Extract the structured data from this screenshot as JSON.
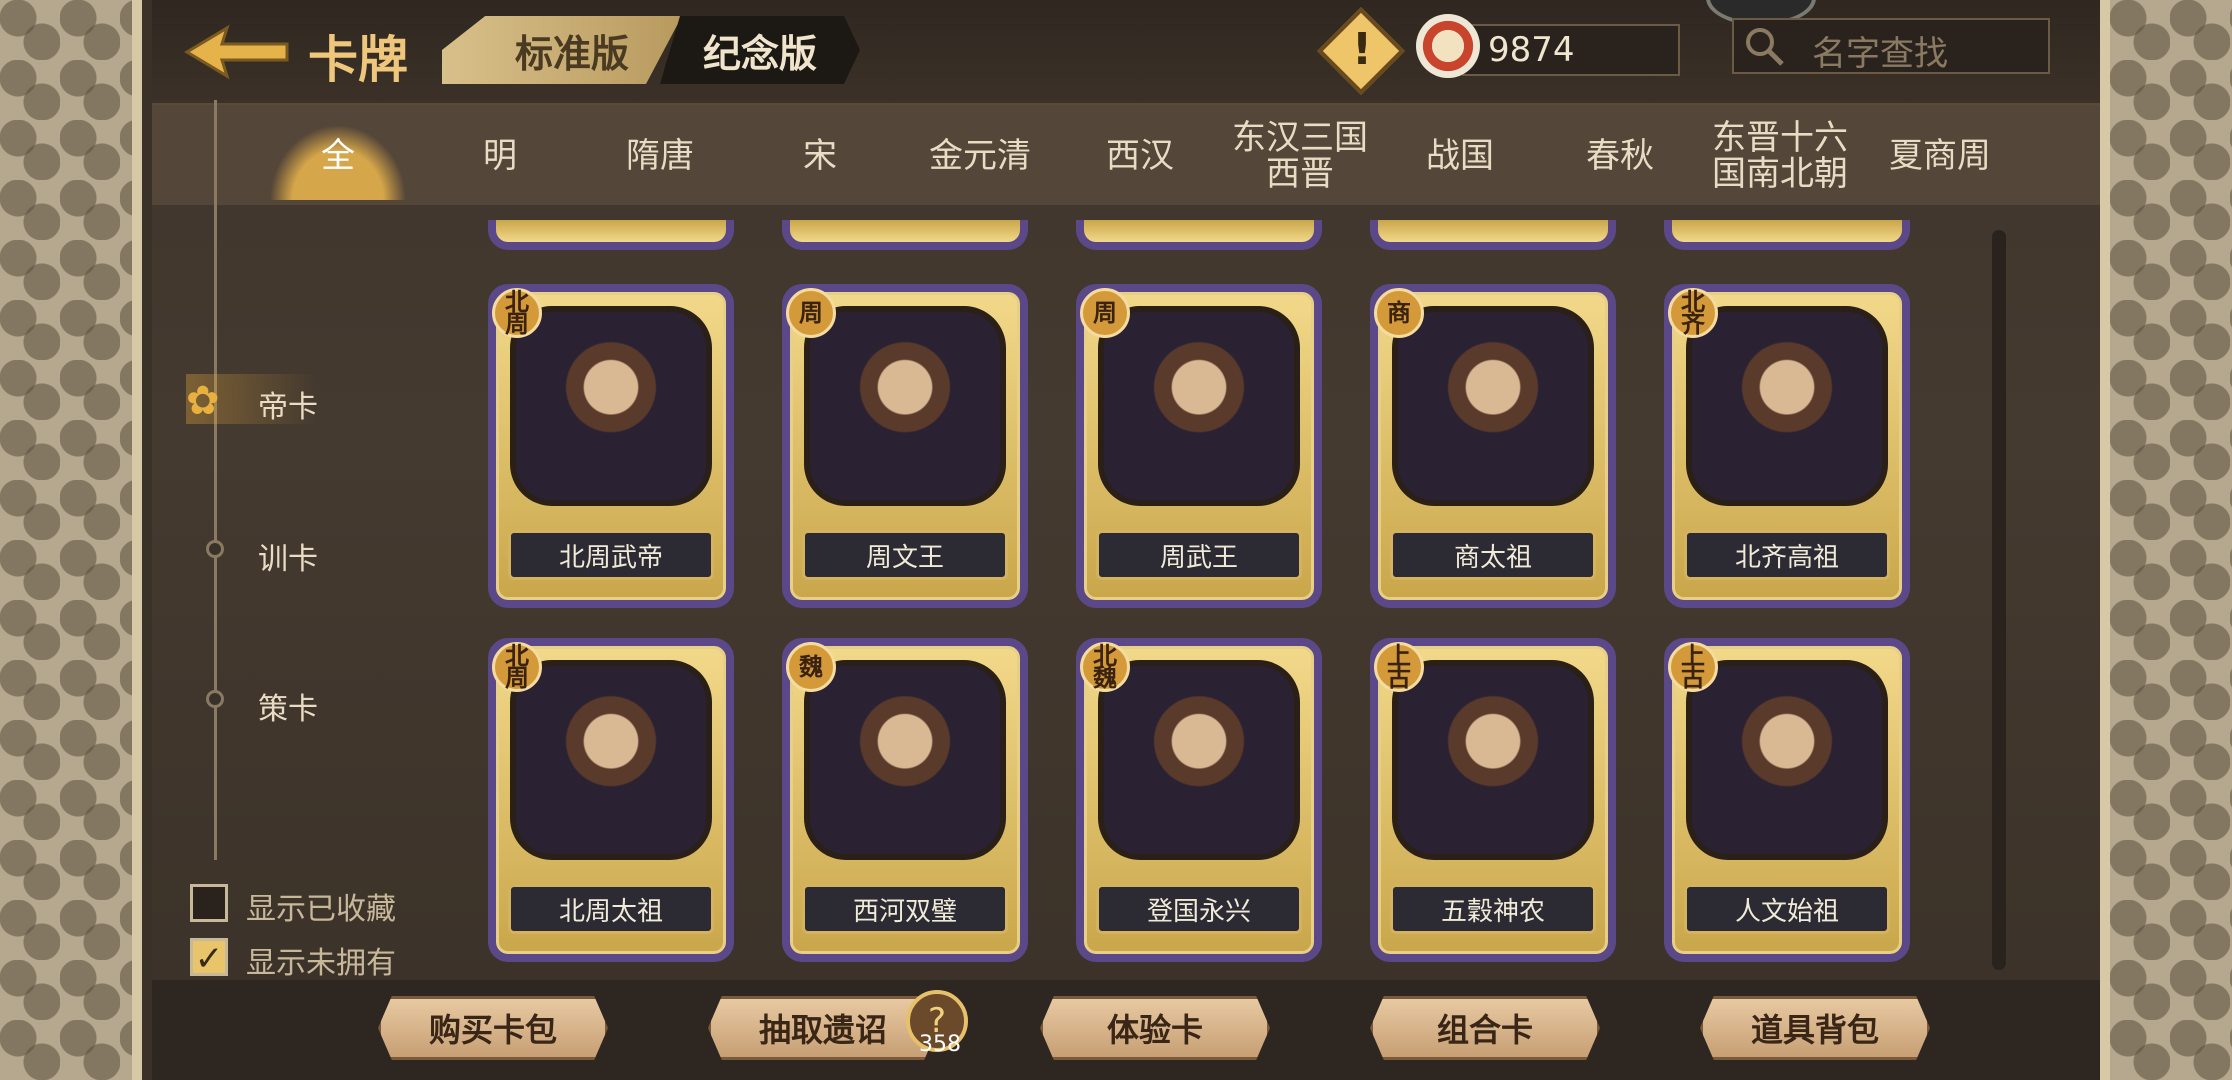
{
  "header": {
    "title": "卡牌",
    "tabs": [
      "标准版",
      "纪念版"
    ],
    "currency_value": "9874",
    "search_placeholder": "名字查找",
    "warning_mark": "!"
  },
  "eras": [
    "全",
    "明",
    "隋唐",
    "宋",
    "金元清",
    "西汉",
    "东汉三国\n西晋",
    "战国",
    "春秋",
    "东晋十六\n国南北朝",
    "夏商周"
  ],
  "side_nav": {
    "items": [
      "帝卡",
      "训卡",
      "策卡"
    ],
    "filters": [
      {
        "label": "显示已收藏",
        "checked": false
      },
      {
        "label": "显示未拥有",
        "checked": true
      }
    ]
  },
  "cards_row1": [
    {
      "name": "北周武帝",
      "badge": "北周"
    },
    {
      "name": "周文王",
      "badge": "周"
    },
    {
      "name": "周武王",
      "badge": "周"
    },
    {
      "name": "商太祖",
      "badge": "商"
    },
    {
      "name": "北齐高祖",
      "badge": "北齐"
    }
  ],
  "cards_row2": [
    {
      "name": "北周太祖",
      "badge": "北周"
    },
    {
      "name": "西河双璧",
      "badge": "魏"
    },
    {
      "name": "登国永兴",
      "badge": "北魏"
    },
    {
      "name": "五穀神农",
      "badge": "上古"
    },
    {
      "name": "人文始祖",
      "badge": "上古"
    }
  ],
  "bottom": {
    "buttons": [
      "购买卡包",
      "抽取遗诏",
      "体验卡",
      "组合卡",
      "道具背包"
    ],
    "lottery_count": "358",
    "lottery_icon": "?"
  }
}
